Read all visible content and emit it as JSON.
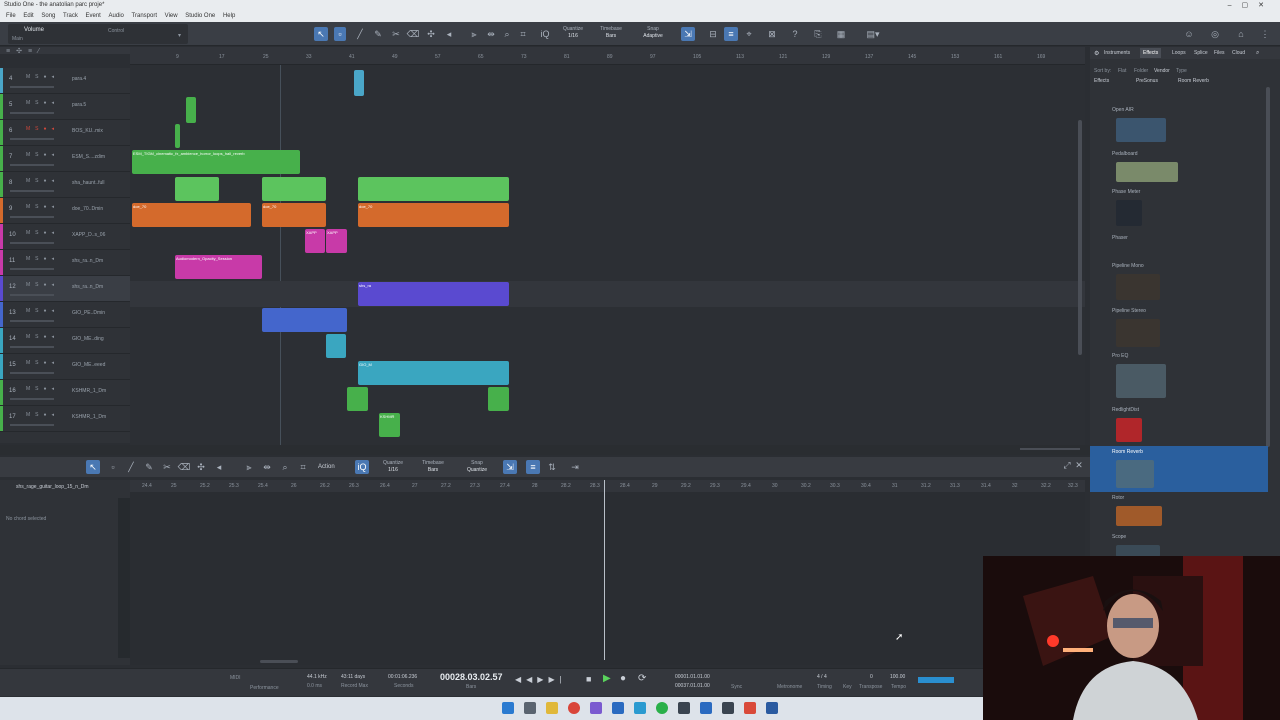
{
  "window": {
    "title": "Studio One - the anatolian parc proje*"
  },
  "menu": [
    "File",
    "Edit",
    "Song",
    "Track",
    "Event",
    "Audio",
    "Transport",
    "View",
    "Studio One",
    "Help"
  ],
  "toolbar": {
    "track_label": "Volume",
    "main_label": "Main",
    "control_label": "Control",
    "quantize_label": "Quantize",
    "quantize_value": "1/16",
    "timebase_label": "Timebase",
    "timebase_value": "Bars",
    "snap_label": "Snap",
    "snap_value": "Adaptive"
  },
  "ruler_ticks": [
    "9",
    "17",
    "25",
    "33",
    "41",
    "49",
    "57",
    "65",
    "73",
    "81",
    "89",
    "97",
    "105",
    "113",
    "121",
    "129",
    "137",
    "145",
    "153",
    "161",
    "169"
  ],
  "tracks": [
    {
      "num": "4",
      "name": "para.4",
      "color": "#4aa6c8"
    },
    {
      "num": "5",
      "name": "para.5",
      "color": "#47b04b"
    },
    {
      "num": "6",
      "name": "BOS_KU..mix",
      "color": "#47b04b"
    },
    {
      "num": "7",
      "name": "ESM_S....zdim",
      "color": "#47b04b"
    },
    {
      "num": "8",
      "name": "sha_haunt..full",
      "color": "#47b04b"
    },
    {
      "num": "9",
      "name": "doe_70..Dmin",
      "color": "#d46a2c"
    },
    {
      "num": "10",
      "name": "XAPP_D..s_06",
      "color": "#c83aa8"
    },
    {
      "num": "11",
      "name": "shs_ra..n_Dm",
      "color": "#c83aa8"
    },
    {
      "num": "12",
      "name": "shs_ra..n_Dm",
      "color": "#5a4ad0"
    },
    {
      "num": "13",
      "name": "GIO_PE..Dmin",
      "color": "#4466cc"
    },
    {
      "num": "14",
      "name": "GIO_ME..ding",
      "color": "#3aa6c0"
    },
    {
      "num": "15",
      "name": "GIO_ME..eeed",
      "color": "#3aa6c0"
    },
    {
      "num": "16",
      "name": "KSHMR_1_Dm",
      "color": "#47b04b"
    },
    {
      "num": "17",
      "name": "KSHMR_1_Dm",
      "color": "#47b04b"
    }
  ],
  "clips": {
    "esm": "ESM_TIGM_cinematic_fx_ambience_horror_loops_hall_reverb",
    "doe": "doe_70",
    "xapp": "XAPP",
    "xapp2": "XAPP",
    "audio": "Audiomodern_Opacity_Session",
    "shs": "shs_ra",
    "gio": "GIO_M",
    "kshmr": "KSHMR"
  },
  "editor": {
    "action_label": "Action",
    "quantize_label": "Quantize",
    "quantize_value": "1/16",
    "timebase_label": "Timebase",
    "timebase_value": "Bars",
    "snap_label": "Snap",
    "snap_value": "Quantize",
    "clip_name": "shs_rage_guitar_loop_15_n_Dm",
    "chord_label": "No chord selected",
    "ruler": [
      "24.4",
      "25",
      "25.2",
      "25.3",
      "25.4",
      "26",
      "26.2",
      "26.3",
      "26.4",
      "27",
      "27.2",
      "27.3",
      "27.4",
      "28",
      "28.2",
      "28.3",
      "28.4",
      "29",
      "29.2",
      "29.3",
      "29.4",
      "30",
      "30.2",
      "30.3",
      "30.4",
      "31",
      "31.2",
      "31.3",
      "31.4",
      "32",
      "32.2",
      "32.3"
    ]
  },
  "transport": {
    "midi": "MIDI",
    "performance": "Performance",
    "rate": "44.1 kHz",
    "rate_sub": "0.0 ms",
    "days": "43:11 days",
    "record_max": "Record Max",
    "seconds": "00:01:06.236",
    "seconds_label": "Seconds",
    "position": "00028.03.02.57",
    "bars": "Bars",
    "loop_start": "00001.01.01.00",
    "loop_end": "00037.01.01.00",
    "sync": "Sync",
    "metronome": "Metronome",
    "signature": "4 / 4",
    "timing": "Timing",
    "key": "Key",
    "transpose_value": "0",
    "transpose": "Transpose",
    "tempo_value": "100.00",
    "tempo": "Tempo"
  },
  "browser": {
    "tabs": [
      "Instruments",
      "Effects",
      "Loops",
      "Splice",
      "Files",
      "Cloud"
    ],
    "active_tab": "Effects",
    "sort_by": "Sort by:",
    "sort_options": [
      "Flat",
      "Folder",
      "Vendor",
      "Type"
    ],
    "breadcrumb": [
      "Effects",
      "PreSonus",
      "Room Reverb"
    ],
    "items": [
      "Open AIR",
      "Pedalboard",
      "Phase Meter",
      "Phaser",
      "Pipeline Mono",
      "Pipeline Stereo",
      "Pro EQ",
      "RedlightDist",
      "Room Reverb",
      "Rotor",
      "Scope"
    ],
    "selected": "Room Reverb"
  }
}
